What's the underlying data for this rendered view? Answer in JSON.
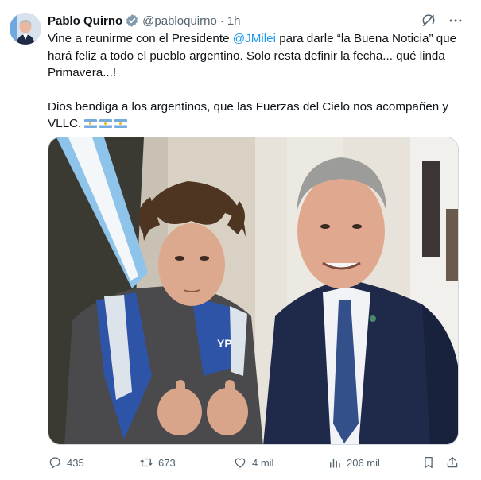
{
  "tweet": {
    "author_name": "Pablo Quirno",
    "handle": "@pabloquirno",
    "separator": "·",
    "time": "1h",
    "text_part1": "Vine a reunirme con el Presidente ",
    "mention": "@JMilei",
    "text_part2": " para darle “la Buena Noticia” que hará feliz a todo el pueblo argentino. Solo resta definir la fecha... qué linda Primavera...!",
    "text_para2": "Dios bendiga a los argentinos, que las Fuerzas del  Cielo nos acompañen y VLLC.",
    "flags": [
      "argentina-flag-emoji",
      "argentina-flag-emoji",
      "argentina-flag-emoji"
    ]
  },
  "media": {
    "jacket_text": "YP"
  },
  "actions": {
    "replies": "435",
    "reposts": "673",
    "likes": "4 mil",
    "views": "206 mil"
  },
  "icons": {
    "verified": "verified-badge-icon",
    "grok": "grok-icon",
    "more": "more-icon",
    "reply": "reply-icon",
    "repost": "repost-icon",
    "like": "like-icon",
    "views": "views-icon",
    "bookmark": "bookmark-icon",
    "share": "share-icon"
  },
  "colors": {
    "accent": "#1d9bf0",
    "muted": "#536471",
    "text": "#0f1419"
  }
}
